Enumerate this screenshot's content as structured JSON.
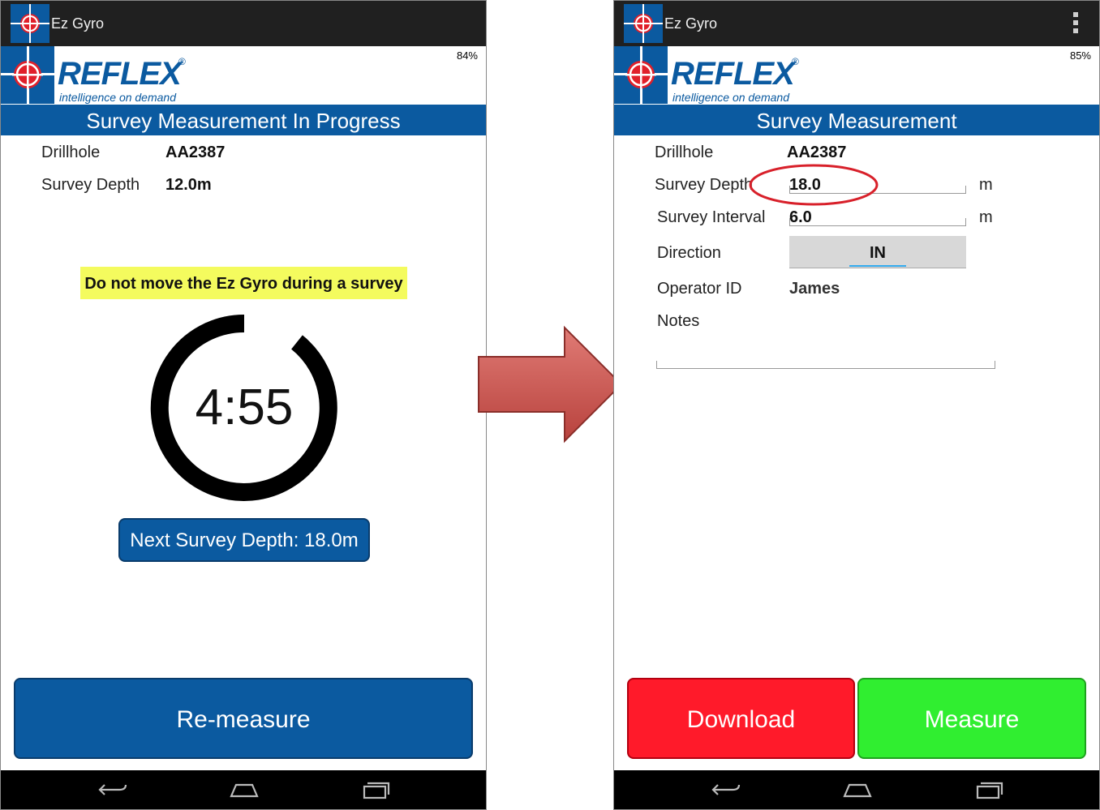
{
  "left_screen": {
    "app_title": "Ez Gyro",
    "battery": "84%",
    "logo": {
      "name": "REFLEX",
      "reg": "®",
      "tagline": "intelligence on demand"
    },
    "header": "Survey Measurement In Progress",
    "drillhole_label": "Drillhole",
    "drillhole_value": "AA2387",
    "depth_label": "Survey Depth",
    "depth_value": "12.0m",
    "warning": "Do not move the Ez Gyro during a survey",
    "timer": "4:55",
    "next_depth_button": "Next Survey Depth: 18.0m",
    "remeasure_button": "Re-measure"
  },
  "right_screen": {
    "app_title": "Ez Gyro",
    "battery": "85%",
    "logo": {
      "name": "REFLEX",
      "reg": "®",
      "tagline": "intelligence on demand"
    },
    "header": "Survey Measurement",
    "drillhole_label": "Drillhole",
    "drillhole_value": "AA2387",
    "depth_label": "Survey Depth",
    "depth_value": "18.0",
    "depth_unit": "m",
    "interval_label": "Survey Interval",
    "interval_value": "6.0",
    "interval_unit": "m",
    "direction_label": "Direction",
    "direction_value": "IN",
    "operator_label": "Operator ID",
    "operator_value": "James",
    "notes_label": "Notes",
    "notes_value": "",
    "download_button": "Download",
    "measure_button": "Measure"
  },
  "colors": {
    "brand_blue": "#0b5aa0",
    "warning_yellow": "#f4fb5e",
    "download_red": "#ff1a2a",
    "measure_green": "#30ee30",
    "arrow_red": "#d05a55",
    "highlight_red": "#d8202a"
  },
  "icons": {
    "app": "crosshair-icon",
    "overflow": "overflow-menu-icon",
    "nav_back": "back-icon",
    "nav_home": "home-icon",
    "nav_recents": "recents-icon"
  }
}
